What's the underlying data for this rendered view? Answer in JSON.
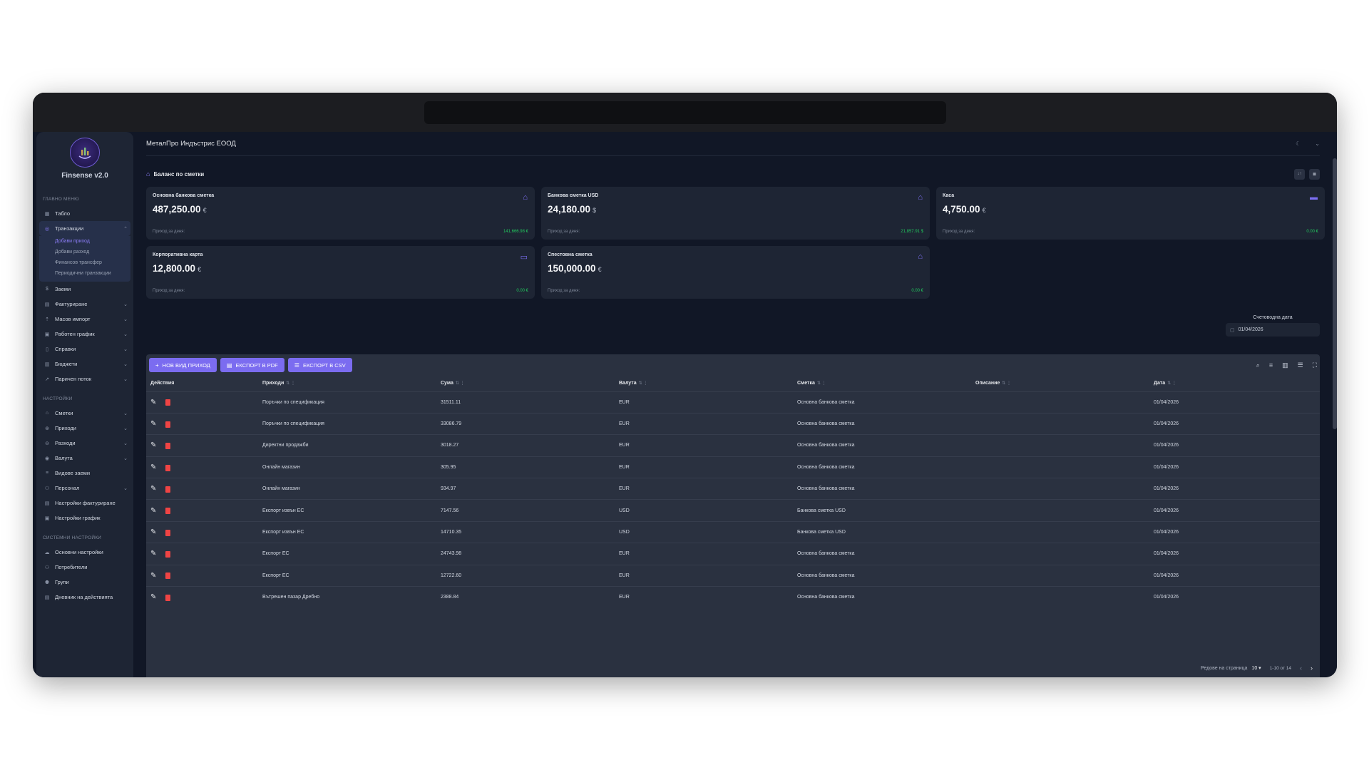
{
  "app": {
    "name": "Finsense v2.0"
  },
  "company": {
    "name": "МеталПро Индъстрис ЕООД"
  },
  "sidebar": {
    "main_title": "ГЛАВНО МЕНЮ",
    "main_items": [
      {
        "label": "Табло",
        "icon": "grid-icon"
      },
      {
        "label": "Транзакции",
        "icon": "transactions-icon"
      },
      {
        "label": "Заеми",
        "icon": "dollar-icon"
      },
      {
        "label": "Фактуриране",
        "icon": "invoice-icon"
      },
      {
        "label": "Масов импорт",
        "icon": "upload-icon"
      },
      {
        "label": "Работен график",
        "icon": "calendar-icon"
      },
      {
        "label": "Справки",
        "icon": "report-icon"
      },
      {
        "label": "Бюджети",
        "icon": "budget-icon"
      },
      {
        "label": "Паричен поток",
        "icon": "trend-icon"
      }
    ],
    "transactions_sub": [
      "Добави приход",
      "Добави разход",
      "Финансов трансфер",
      "Периодични транзакции"
    ],
    "settings_title": "НАСТРОЙКИ",
    "settings_items": [
      {
        "label": "Сметки"
      },
      {
        "label": "Приходи"
      },
      {
        "label": "Разходи"
      },
      {
        "label": "Валута"
      },
      {
        "label": "Видове заеми"
      },
      {
        "label": "Персонал"
      },
      {
        "label": "Настройки фактуриране"
      },
      {
        "label": "Настройки график"
      }
    ],
    "system_title": "СИСТЕМНИ НАСТРОЙКИ",
    "system_items": [
      {
        "label": "Основни настройки"
      },
      {
        "label": "Потребители"
      },
      {
        "label": "Групи"
      },
      {
        "label": "Дневник на действията"
      }
    ]
  },
  "balance": {
    "title": "Баланс по сметки",
    "cards": [
      {
        "name": "Основна банкова сметка",
        "amount": "487,250.00",
        "currency": "€",
        "foot_label": "Приход за деня:",
        "foot_value": "141,666.98 €",
        "icon": "bank-icon"
      },
      {
        "name": "Банкова сметка USD",
        "amount": "24,180.00",
        "currency": "$",
        "foot_label": "Приход за деня:",
        "foot_value": "21,857.91 $",
        "icon": "bank-icon"
      },
      {
        "name": "Каса",
        "amount": "4,750.00",
        "currency": "€",
        "foot_label": "Приход за деня:",
        "foot_value": "0.00 €",
        "icon": "wallet-icon"
      },
      {
        "name": "Корпоративна карта",
        "amount": "12,800.00",
        "currency": "€",
        "foot_label": "Приход за деня:",
        "foot_value": "0.00 €",
        "icon": "card-icon"
      },
      {
        "name": "Спестовна сметка",
        "amount": "150,000.00",
        "currency": "€",
        "foot_label": "Приход за деня:",
        "foot_value": "0.00 €",
        "icon": "bank-icon"
      }
    ]
  },
  "accounting_date": {
    "label": "Счетоводна дата",
    "value": "01/04/2026"
  },
  "toolbar": {
    "new_income": "НОВ ВИД ПРИХОД",
    "export_pdf": "ЕКСПОРТ В PDF",
    "export_csv": "ЕКСПОРТ В CSV"
  },
  "table": {
    "columns": [
      "Действия",
      "Приходи",
      "Сума",
      "Валута",
      "Сметка",
      "Описание",
      "Дата"
    ],
    "rows": [
      [
        "Поръчки по спецификация",
        "31511.11",
        "EUR",
        "Основна банкова сметка",
        "",
        "01/04/2026"
      ],
      [
        "Поръчки по спецификация",
        "33086.79",
        "EUR",
        "Основна банкова сметка",
        "",
        "01/04/2026"
      ],
      [
        "Директни продажби",
        "3018.27",
        "EUR",
        "Основна банкова сметка",
        "",
        "01/04/2026"
      ],
      [
        "Онлайн магазин",
        "305.95",
        "EUR",
        "Основна банкова сметка",
        "",
        "01/04/2026"
      ],
      [
        "Онлайн магазин",
        "934.97",
        "EUR",
        "Основна банкова сметка",
        "",
        "01/04/2026"
      ],
      [
        "Експорт извън ЕС",
        "7147.56",
        "USD",
        "Банкова сметка USD",
        "",
        "01/04/2026"
      ],
      [
        "Експорт извън ЕС",
        "14710.35",
        "USD",
        "Банкова сметка USD",
        "",
        "01/04/2026"
      ],
      [
        "Експорт ЕС",
        "24743.98",
        "EUR",
        "Основна банкова сметка",
        "",
        "01/04/2026"
      ],
      [
        "Експорт ЕС",
        "12722.60",
        "EUR",
        "Основна банкова сметка",
        "",
        "01/04/2026"
      ],
      [
        "Вътрешен пазар Дребно",
        "2388.84",
        "EUR",
        "Основна банкова сметка",
        "",
        "01/04/2026"
      ]
    ]
  },
  "pager": {
    "rows_label": "Редове на страница",
    "rows_value": "10",
    "range": "1-10 от 14"
  },
  "colors": {
    "accent": "#7b6cf0",
    "positive": "#22c55e",
    "danger": "#ef4444"
  }
}
